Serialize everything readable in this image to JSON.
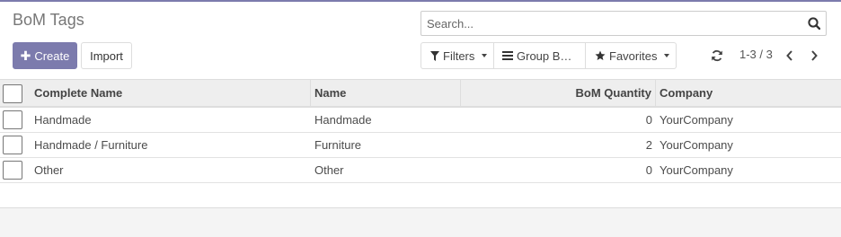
{
  "header": {
    "title": "BoM Tags"
  },
  "search": {
    "placeholder": "Search..."
  },
  "toolbar": {
    "create_label": "Create",
    "import_label": "Import"
  },
  "filters": {
    "filters_label": "Filters",
    "group_by_label": "Group B…",
    "favorites_label": "Favorites"
  },
  "pager": {
    "value": "1-3 / 3"
  },
  "table": {
    "columns": [
      "Complete Name",
      "Name",
      "BoM Quantity",
      "Company"
    ],
    "rows": [
      {
        "complete_name": "Handmade",
        "name": "Handmade",
        "qty": "0",
        "company": "YourCompany"
      },
      {
        "complete_name": "Handmade / Furniture",
        "name": "Furniture",
        "qty": "2",
        "company": "YourCompany"
      },
      {
        "complete_name": "Other",
        "name": "Other",
        "qty": "0",
        "company": "YourCompany"
      }
    ]
  },
  "icons": {
    "search": "search-icon",
    "create": "plus-icon",
    "filters": "filter-icon",
    "group_by": "bars-icon",
    "favorites": "star-icon",
    "refresh": "refresh-icon",
    "prev": "chevron-left-icon",
    "next": "chevron-right-icon"
  },
  "colors": {
    "primary": "#7c7bad",
    "header_bg": "#eeeeee"
  }
}
